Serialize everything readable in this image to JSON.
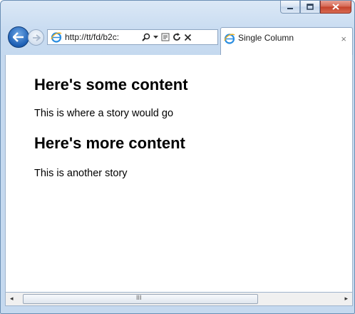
{
  "browser": {
    "address_url": "http://tt/fd/b2c:",
    "tab_title": "Single Column",
    "tab_close_glyph": "×",
    "icons": {
      "back": "back-arrow-icon",
      "forward": "forward-arrow-icon",
      "search": "search-icon",
      "compatibility": "compatibility-view-icon",
      "refresh": "refresh-icon",
      "stop": "stop-icon",
      "ie": "internet-explorer-icon"
    }
  },
  "page": {
    "heading1": "Here's some content",
    "paragraph1": "This is where a story would go",
    "heading2": "Here's more content",
    "paragraph2": "This is another story"
  },
  "scrollbar": {
    "grip": "III",
    "left_arrow": "◂",
    "right_arrow": "▸"
  },
  "colors": {
    "frame": "#c5d9ef",
    "close_button": "#c4412a",
    "back_button": "#1d5fb4"
  }
}
